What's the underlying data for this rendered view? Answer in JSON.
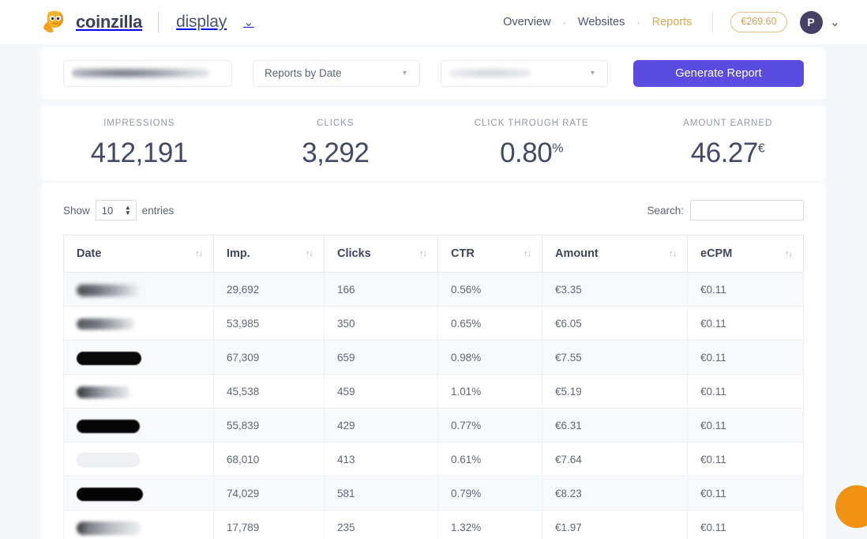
{
  "header": {
    "brand_name": "coinzilla",
    "brand_sub": "display",
    "brand_caret": "⌄",
    "logo_icon": "coinzilla-dinosaur-logo",
    "nav": [
      {
        "label": "Overview",
        "active": false
      },
      {
        "label": "Websites",
        "active": false
      },
      {
        "label": "Reports",
        "active": true
      }
    ],
    "nav_separator": "·",
    "balance": "€269.60",
    "avatar_initial": "P",
    "avatar_caret": "⌄"
  },
  "filters": {
    "date_range_value": "",
    "date_range_redacted": true,
    "report_type_value": "Reports by Date",
    "website_value": "",
    "website_redacted": true,
    "caret": "▼",
    "generate_label": "Generate Report"
  },
  "stats": [
    {
      "label": "IMPRESSIONS",
      "value": "412,191",
      "suffix": ""
    },
    {
      "label": "CLICKS",
      "value": "3,292",
      "suffix": ""
    },
    {
      "label": "CLICK THROUGH RATE",
      "value": "0.80",
      "suffix": "%"
    },
    {
      "label": "AMOUNT EARNED",
      "value": "46.27",
      "suffix": "€"
    }
  ],
  "table_controls": {
    "show_label": "Show",
    "entries_value": "10",
    "entries_label": "entries",
    "search_label": "Search:",
    "search_value": "",
    "spinner_icon": "up-down-spinner-icon"
  },
  "table": {
    "sort_icon": "↑↓",
    "columns": [
      "Date",
      "Imp.",
      "Clicks",
      "CTR",
      "Amount",
      "eCPM"
    ],
    "rows": [
      {
        "date": "",
        "date_redacted": "rd-a",
        "imp": "29,692",
        "clicks": "166",
        "ctr": "0.56%",
        "amount": "€3.35",
        "ecpm": "€0.11"
      },
      {
        "date": "",
        "date_redacted": "rd-b",
        "imp": "53,985",
        "clicks": "350",
        "ctr": "0.65%",
        "amount": "€6.05",
        "ecpm": "€0.11"
      },
      {
        "date": "",
        "date_redacted": "rd-c",
        "imp": "67,309",
        "clicks": "659",
        "ctr": "0.98%",
        "amount": "€7.55",
        "ecpm": "€0.11"
      },
      {
        "date": "",
        "date_redacted": "rd-d",
        "imp": "45,538",
        "clicks": "459",
        "ctr": "1.01%",
        "amount": "€5.19",
        "ecpm": "€0.11"
      },
      {
        "date": "",
        "date_redacted": "rd-e",
        "imp": "55,839",
        "clicks": "429",
        "ctr": "0.77%",
        "amount": "€6.31",
        "ecpm": "€0.11"
      },
      {
        "date": "",
        "date_redacted": "rd-f",
        "imp": "68,010",
        "clicks": "413",
        "ctr": "0.61%",
        "amount": "€7.64",
        "ecpm": "€0.11"
      },
      {
        "date": "",
        "date_redacted": "rd-g",
        "imp": "74,029",
        "clicks": "581",
        "ctr": "0.79%",
        "amount": "€8.23",
        "ecpm": "€0.11"
      },
      {
        "date": "",
        "date_redacted": "rd-h",
        "imp": "17,789",
        "clicks": "235",
        "ctr": "1.32%",
        "amount": "€1.97",
        "ecpm": "€0.11"
      }
    ]
  },
  "chat": {
    "icon": "chat-support-icon"
  },
  "colors": {
    "accent_purple": "#5a4ce0",
    "accent_gold": "#dba94f",
    "chat_orange": "#ef9212",
    "text_navy": "#434a68",
    "page_bg": "#f4f8fb"
  }
}
